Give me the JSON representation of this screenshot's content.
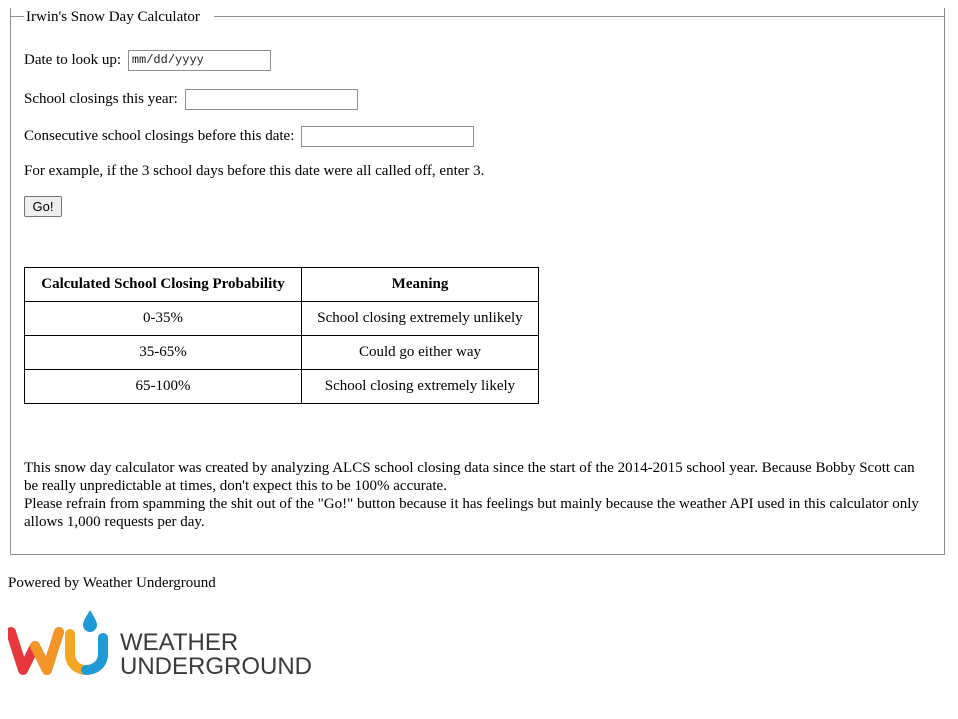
{
  "form": {
    "legend": "Irwin's Snow Day Calculator",
    "date_label": "Date to look up:",
    "date_placeholder": "mm/dd/yyyy",
    "closings_label": "School closings this year:",
    "closings_value": "",
    "consecutive_label": "Consecutive school closings before this date:",
    "consecutive_value": "",
    "example_text": "For example, if the 3 school days before this date were all called off, enter 3.",
    "go_label": "Go!"
  },
  "table": {
    "headers": [
      "Calculated School Closing Probability",
      "Meaning"
    ],
    "rows": [
      [
        "0-35%",
        "School closing extremely unlikely"
      ],
      [
        "35-65%",
        "Could go either way"
      ],
      [
        "65-100%",
        "School closing extremely likely"
      ]
    ]
  },
  "info": {
    "line1": "This snow day calculator was created by analyzing ALCS school closing data since the start of the 2014-2015 school year. Because Bobby Scott can be really unpredictable at times, don't expect this to be 100% accurate.",
    "line2": "Please refrain from spamming the shit out of the \"Go!\" button because it has feelings but mainly because the weather API used in this calculator only allows 1,000 requests per day."
  },
  "footer": {
    "powered_by": "Powered by Weather Underground",
    "logo_line1": "WEATHER",
    "logo_line2": "UNDERGROUND"
  },
  "colors": {
    "logo_text": "#3b3b3b",
    "logo_red": "#e8383d",
    "logo_orange": "#f5a623",
    "logo_blue": "#1e9bd7"
  }
}
